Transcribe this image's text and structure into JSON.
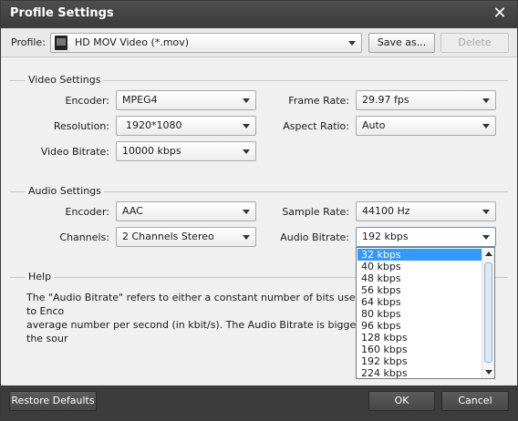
{
  "window": {
    "title": "Profile Settings",
    "close_glyph": "✕"
  },
  "profile": {
    "label": "Profile:",
    "value": "HD MOV Video (*.mov)",
    "save_as_label": "Save as...",
    "delete_label": "Delete"
  },
  "video": {
    "group_title": "Video Settings",
    "encoder_label": "Encoder:",
    "encoder_value": "MPEG4",
    "resolution_label": "Resolution:",
    "resolution_value": "1920*1080",
    "bitrate_label": "Video Bitrate:",
    "bitrate_value": "10000 kbps",
    "framerate_label": "Frame Rate:",
    "framerate_value": "29.97 fps",
    "aspect_label": "Aspect Ratio:",
    "aspect_value": "Auto"
  },
  "audio": {
    "group_title": "Audio Settings",
    "encoder_label": "Encoder:",
    "encoder_value": "AAC",
    "channels_label": "Channels:",
    "channels_value": "2 Channels Stereo",
    "samplerate_label": "Sample Rate:",
    "samplerate_value": "44100 Hz",
    "bitrate_label": "Audio Bitrate:",
    "bitrate_value": "192 kbps",
    "bitrate_options": [
      "32 kbps",
      "40 kbps",
      "48 kbps",
      "56 kbps",
      "64 kbps",
      "80 kbps",
      "96 kbps",
      "128 kbps",
      "160 kbps",
      "192 kbps",
      "224 kbps"
    ],
    "highlighted_option": "32 kbps"
  },
  "help": {
    "group_title": "Help",
    "text_line1": "The \"Audio Bitrate\" refers to either a constant number of bits used to Enco",
    "text_line2": "average number per second (in kbit/s). The Audio Bitrate is bigger, the sour"
  },
  "footer": {
    "restore_label": "Restore Defaults",
    "ok_label": "OK",
    "cancel_label": "Cancel"
  },
  "colors": {
    "titlebar": "#3f3f3f",
    "selection": "#3399ff",
    "footer": "#3c3c3c"
  }
}
